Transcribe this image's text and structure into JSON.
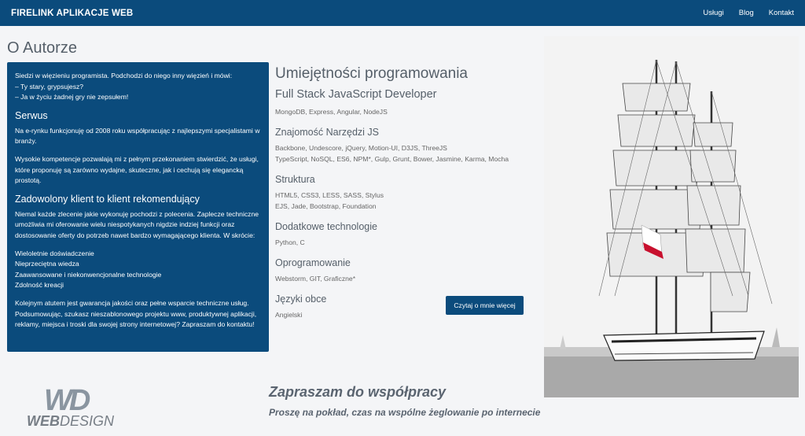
{
  "navbar": {
    "brand": "FIRELINK APLIKACJE WEB",
    "links": [
      "Usługi",
      "Blog",
      "Kontakt"
    ]
  },
  "page_title": "O Autorze",
  "intro": {
    "paragraph": [
      "Siedzi w więzieniu programista. Podchodzi do niego inny więzień i mówi:",
      "– Ty stary, grypsujesz?",
      "– Ja w życiu żadnej gry nie zepsułem!"
    ],
    "serwus_title": "Serwus",
    "serwus_p1": "Na e-rynku funkcjonuję od 2008 roku współpracując z najlepszymi specjalistami w branży.",
    "serwus_p2": "Wysokie kompetencje pozwalają mi z pełnym przekonaniem stwierdzić, że usługi, które proponuję są zarówno wydajne, skuteczne, jak i cechują się elegancką prostotą.",
    "client_title": "Zadowolony klient to klient rekomendujący",
    "client_p1": "Niemal każde zlecenie jakie wykonuję pochodzi z polecenia. Zaplecze techniczne umożliwia mi oferowanie wielu niespotykanych nigdzie indziej funkcji oraz dostosowanie oferty do potrzeb nawet bardzo wymagającego klienta. W skrócie:",
    "list": [
      "Wieloletnie doświadczenie",
      "Nieprzeciętna wiedza",
      "Zaawansowane i niekonwencjonalne technologie",
      "Zdolność kreacji"
    ],
    "closing": "Kolejnym atutem jest gwarancja jakości oraz pełne wsparcie techniczne usług. Podsumowując, szukasz nieszablonowego projektu www, produktywnej aplikacji, reklamy, miejsca i troski dla swojej strony internetowej? Zapraszam do kontaktu!"
  },
  "skills": {
    "title": "Umiejętności programowania",
    "fullstack_title": "Full Stack JavaScript Developer",
    "fullstack_line": "MongoDB, Express, Angular, NodeJS",
    "tools_title": "Znajomość Narzędzi JS",
    "tools_line1": "Backbone, Undescore, jQuery, Motion-UI, D3JS, ThreeJS",
    "tools_line2": "TypeScript, NoSQL, ES6, NPM*, Gulp, Grunt, Bower, Jasmine, Karma, Mocha",
    "struct_title": "Struktura",
    "struct_line1": "HTML5, CSS3, LESS, SASS, Stylus",
    "struct_line2": "EJS, Jade, Bootstrap, Foundation",
    "extra_title": "Dodatkowe technologie",
    "extra_line": "Python, C",
    "software_title": "Oprogramowanie",
    "software_line": "Webstorm, GIT, Graficzne*",
    "lang_title": "Języki obce",
    "lang_line": "Angielski"
  },
  "cta_label": "Czytaj o mnie więcej",
  "ship_flag_color": "#c8102e",
  "logo": {
    "mark": "WD",
    "web": "WEB",
    "design": "DESIGN"
  },
  "invite": {
    "title": "Zapraszam do współpracy",
    "subtitle": "Proszę na pokład, czas na wspólne żeglowanie po internecie"
  },
  "colors": {
    "primary": "#0b4b7c",
    "background": "#f4f5f7"
  }
}
